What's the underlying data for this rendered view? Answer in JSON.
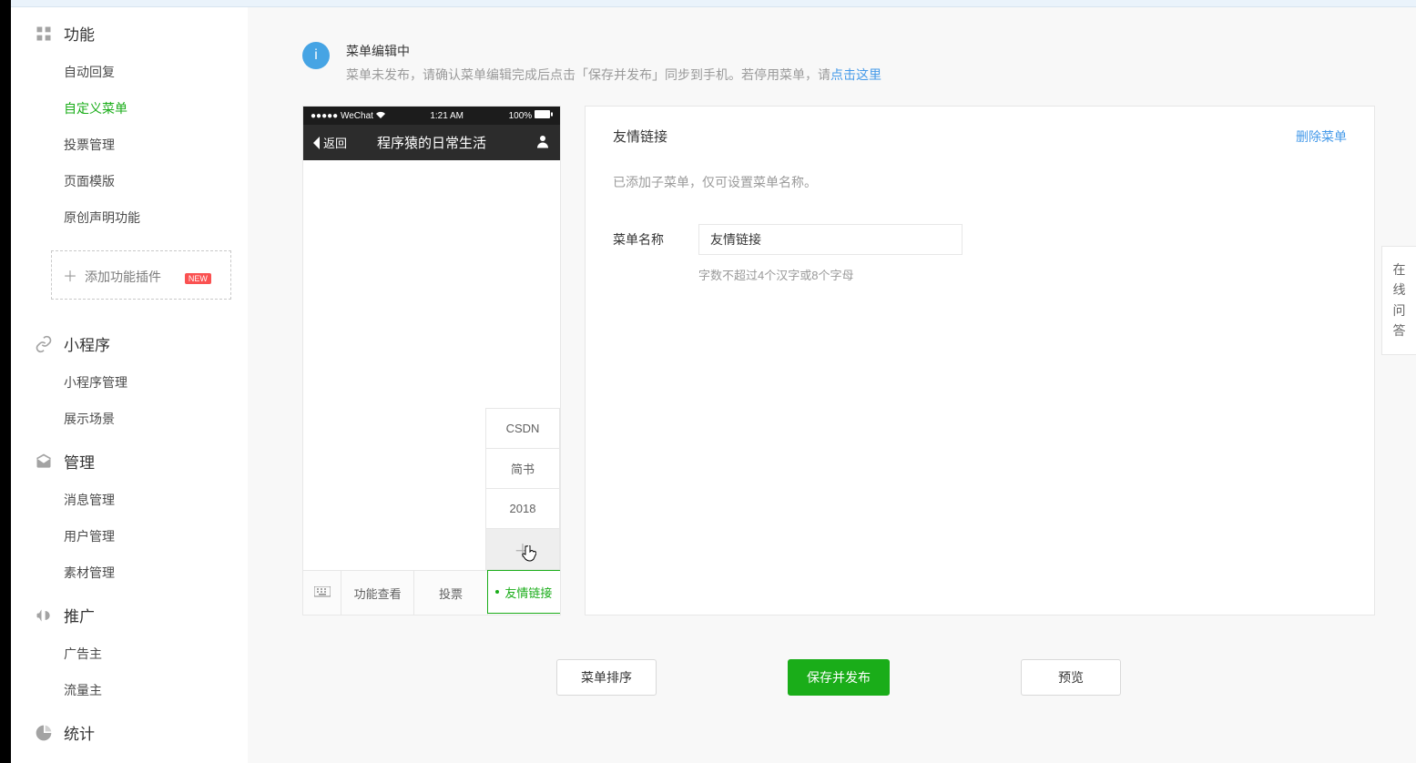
{
  "sidebar": {
    "cat_functions": "功能",
    "items_functions": [
      "自动回复",
      "自定义菜单",
      "投票管理",
      "页面模版",
      "原创声明功能"
    ],
    "active_function_index": 1,
    "add_plugin": "添加功能插件",
    "badge_new": "NEW",
    "cat_miniprogram": "小程序",
    "items_miniprogram": [
      "小程序管理",
      "展示场景"
    ],
    "cat_management": "管理",
    "items_management": [
      "消息管理",
      "用户管理",
      "素材管理"
    ],
    "cat_promotion": "推广",
    "items_promotion": [
      "广告主",
      "流量主"
    ],
    "cat_stats": "统计"
  },
  "notice": {
    "title": "菜单编辑中",
    "body_a": "菜单未发布，请确认菜单编辑完成后点击「保存并发布」同步到手机。若停用菜单，请",
    "link": "点击这里"
  },
  "phone": {
    "status_left": "●●●●● WeChat",
    "status_time": "1:21 AM",
    "status_batt": "100%",
    "back_label": "返回",
    "title": "程序猿的日常生活",
    "submenu": [
      "CSDN",
      "简书",
      "2018"
    ],
    "bottom": [
      "功能查看",
      "投票",
      "友情链接"
    ],
    "bottom_active_index": 2
  },
  "detail": {
    "title": "友情链接",
    "delete": "删除菜单",
    "sub_tip": "已添加子菜单，仅可设置菜单名称。",
    "name_label": "菜单名称",
    "name_value": "友情链接",
    "name_hint": "字数不超过4个汉字或8个字母"
  },
  "actions": {
    "sort": "菜单排序",
    "preview": "预览",
    "save_publish": "保存并发布"
  },
  "floater": "在线问答"
}
